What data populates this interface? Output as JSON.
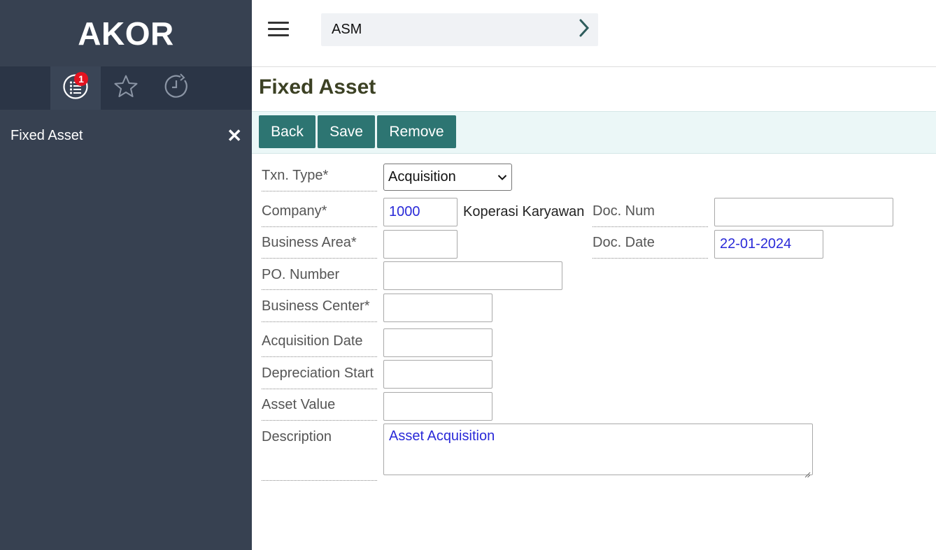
{
  "brand": "AKOR",
  "sidebar": {
    "tabs": [
      {
        "icon": "list-icon",
        "badge": "1",
        "active": true
      },
      {
        "icon": "star-icon",
        "active": false
      },
      {
        "icon": "history-icon",
        "active": false
      }
    ],
    "item": {
      "label": "Fixed Asset",
      "close": "✕"
    }
  },
  "header": {
    "module": "ASM"
  },
  "page": {
    "title": "Fixed Asset"
  },
  "toolbar": {
    "back": "Back",
    "save": "Save",
    "remove": "Remove"
  },
  "form": {
    "txn_type": {
      "label": "Txn. Type*",
      "value": "Acquisition"
    },
    "company": {
      "label": "Company*",
      "value": "1000",
      "name": "Koperasi Karyawan"
    },
    "doc_num": {
      "label": "Doc. Num",
      "value": ""
    },
    "business_area": {
      "label": "Business Area*",
      "value": ""
    },
    "doc_date": {
      "label": "Doc. Date",
      "value": "22-01-2024"
    },
    "po_number": {
      "label": "PO. Number",
      "value": ""
    },
    "business_center": {
      "label": "Business Center*",
      "value": ""
    },
    "acquisition_date": {
      "label": "Acquisition Date",
      "value": ""
    },
    "depreciation_start": {
      "label": "Depreciation Start",
      "value": ""
    },
    "asset_value": {
      "label": "Asset Value",
      "value": ""
    },
    "description": {
      "label": "Description",
      "value": "Asset Acquisition"
    }
  },
  "colors": {
    "sidebar_bg": "#374151",
    "button_bg": "#2d7572",
    "toolbar_bg": "#ebf7f7",
    "title_color": "#3c4124",
    "value_color": "#2929d8",
    "badge_bg": "#e3131f"
  }
}
